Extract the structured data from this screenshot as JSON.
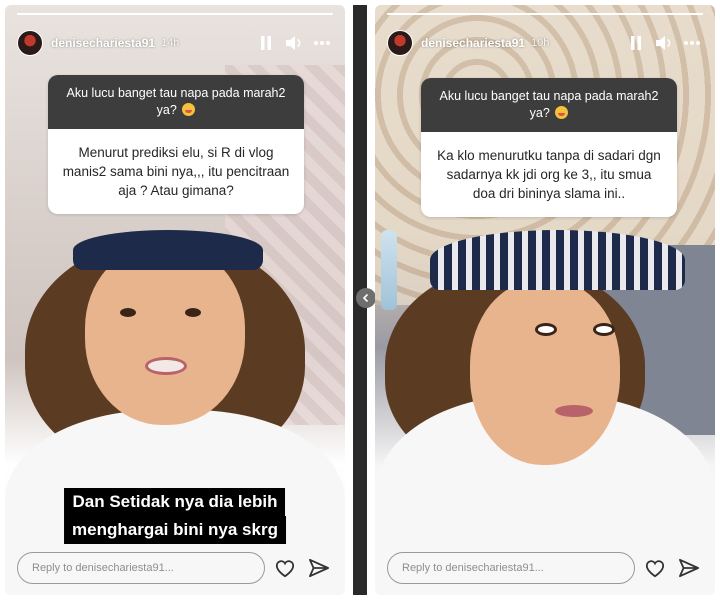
{
  "colors": {
    "question_header_bg": "#3d3d3d",
    "question_body_bg": "#ffffff",
    "caption_bg": "#000000",
    "nav_arrow_bg": "#6e6e6e"
  },
  "stories": [
    {
      "username": "denisechariesta91",
      "time_ago": "14h",
      "progress": 1.0,
      "question_prompt": "Aku lucu banget tau napa pada marah2 ya?",
      "question_emoji": "zany-face",
      "answer": "Menurut prediksi elu, si R di vlog manis2 sama bini nya,,, itu pencitraan aja ? Atau gimana?",
      "caption_line1": "Dan Setidak nya dia lebih",
      "caption_line2": "menghargai bini nya skrg",
      "reply_placeholder": "Reply to denisechariesta91...",
      "icons": [
        "pause-icon",
        "speaker-icon",
        "more-icon",
        "heart-icon",
        "send-icon"
      ]
    },
    {
      "username": "denisechariesta91",
      "time_ago": "10h",
      "progress": 1.0,
      "question_prompt": "Aku lucu banget tau napa pada marah2 ya?",
      "question_emoji": "zany-face",
      "answer": "Ka klo menurutku tanpa di sadari dgn sadarnya kk jdi org ke 3,, itu smua doa dri bininya slama ini..",
      "reply_placeholder": "Reply to denisechariesta91...",
      "icons": [
        "pause-icon",
        "speaker-icon",
        "more-icon",
        "heart-icon",
        "send-icon"
      ]
    }
  ],
  "navigation": {
    "previous_icon": "chevron-left-icon"
  }
}
